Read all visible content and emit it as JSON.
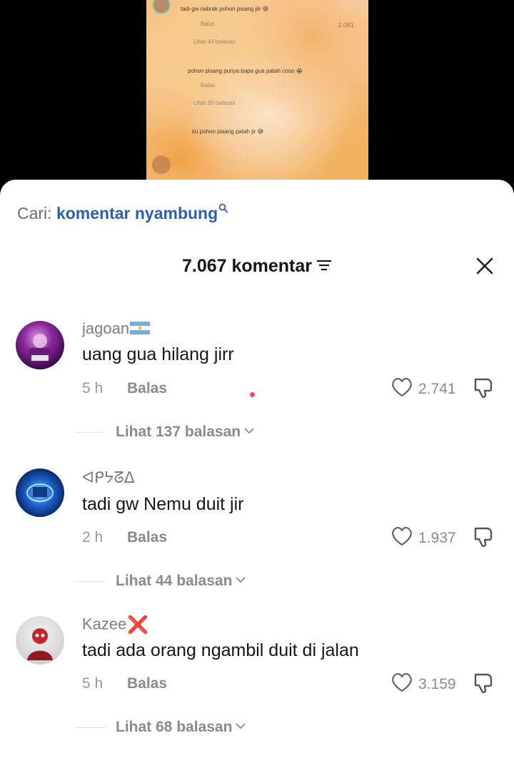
{
  "video": {
    "lines": [
      "tadi gw nabrak pohon pisang jiir 😅",
      "Balas",
      "Lihat 43 balasan",
      "pohon pisang punya bapa gua patah cooo 😭",
      "Balas",
      "Lihat 30 balasan",
      "itu pohon pisang patah jir 😅",
      "2.081"
    ]
  },
  "search": {
    "prefix": "Cari:",
    "keyword": "komentar nyambung"
  },
  "header": {
    "title": "7.067 komentar"
  },
  "comments": [
    {
      "username": "jagoan",
      "flag": "argentina-flag",
      "text": "uang gua hilang jirr",
      "time": "5 h",
      "reply": "Balas",
      "likes": "2.741",
      "view_replies": "Lihat 137 balasan"
    },
    {
      "username": "ᐊᑭᔭᘔᐃ",
      "text": "tadi gw Nemu duit jir",
      "time": "2 h",
      "reply": "Balas",
      "likes": "1.937",
      "view_replies": "Lihat 44 balasan"
    },
    {
      "username": "Kazee",
      "badge": "❌",
      "text": "tadi ada orang ngambil duit di jalan",
      "time": "5 h",
      "reply": "Balas",
      "likes": "3.159",
      "view_replies": "Lihat 68 balasan"
    }
  ],
  "colors": {
    "accent": "#2f5fa8",
    "sheet": "#ffffff",
    "muted": "#8a8a8a"
  }
}
